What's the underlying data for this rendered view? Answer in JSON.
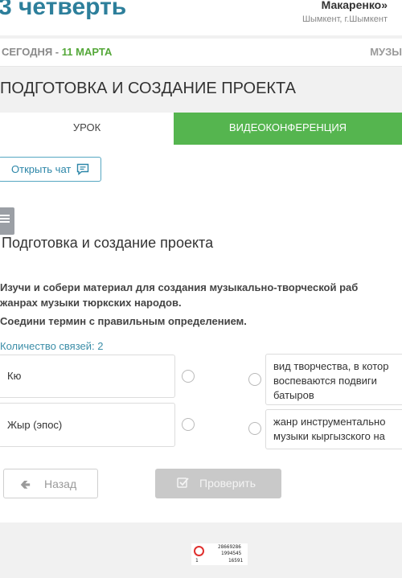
{
  "header": {
    "quarter": "3 четверть",
    "school": "Макаренко»",
    "city": "Шымкент, г.Шымкент"
  },
  "strip": {
    "today_label": "СЕГОДНЯ -",
    "today_date": "11 МАРТА",
    "subject": "МУЗЫ"
  },
  "lesson_title": "ПОДГОТОВКА И СОЗДАНИЕ ПРОЕКТА",
  "tabs": [
    {
      "label": "УРОК",
      "active": true
    },
    {
      "label": "ВИДЕОКОНФЕРЕНЦИЯ",
      "active": false
    }
  ],
  "chat_button": {
    "label": "Открыть чат",
    "icon": "chat-icon"
  },
  "task": {
    "title": "Подготовка и создание проекта",
    "text_lines": [
      "Изучи и собери материал для создания музыкально-творческой раб",
      "жанрах музыки тюркских народов."
    ],
    "instruction": "Соедини термин с правильным определением.",
    "links_count": "Количество связей: 2"
  },
  "terms": [
    "Кю",
    "Жыр (эпос)"
  ],
  "definitions": [
    [
      "вид творчества, в котор",
      "воспеваются подвиги",
      "батыров"
    ],
    [
      "жанр инструментально",
      "музыки кыргызского на"
    ]
  ],
  "buttons": {
    "back": "Назад",
    "check": "Проверить"
  },
  "footer": {
    "code1": "28669286",
    "code2": "1994545",
    "code3": "1",
    "code4": "16591"
  },
  "colors": {
    "accent_blue": "#2d7f9b",
    "accent_green": "#55b54f",
    "date_green": "#55a83a"
  }
}
